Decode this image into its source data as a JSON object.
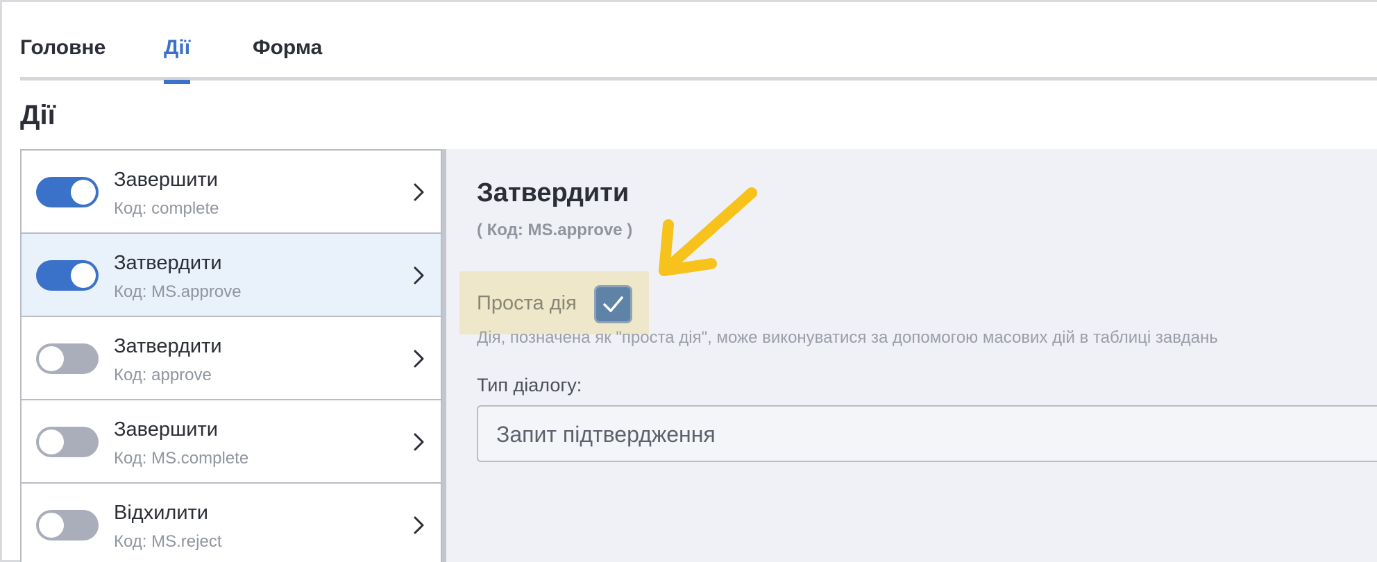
{
  "tabs": [
    {
      "label": "Головне"
    },
    {
      "label": "Дії"
    },
    {
      "label": "Форма"
    }
  ],
  "section": {
    "title": "Дії"
  },
  "actions": [
    {
      "title": "Завершити",
      "code": "Код: complete",
      "enabled": true
    },
    {
      "title": "Затвердити",
      "code": "Код: MS.approve",
      "enabled": true
    },
    {
      "title": "Затвердити",
      "code": "Код: approve",
      "enabled": false
    },
    {
      "title": "Завершити",
      "code": "Код: MS.complete",
      "enabled": false
    },
    {
      "title": "Відхилити",
      "code": "Код: MS.reject",
      "enabled": false
    }
  ],
  "detail": {
    "title": "Затвердити",
    "code": "( Код: MS.approve )",
    "simple_action_label": "Проста дія",
    "simple_action_checked": true,
    "hint": "Дія, позначена як \"проста дія\", може виконуватися за допомогою масових дій в таблиці завдань",
    "dialog_type_label": "Тип діалогу:",
    "dialog_type_value": "Запит підтвердження"
  },
  "colors": {
    "accent": "#3b72c9",
    "annotation_arrow": "#f7c21b",
    "highlight": "#efe7c9"
  }
}
